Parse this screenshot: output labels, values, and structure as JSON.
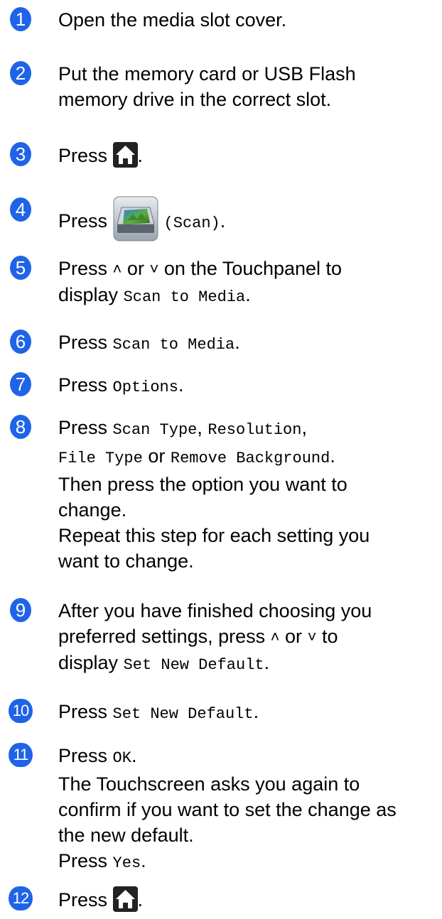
{
  "steps": [
    {
      "num": "1",
      "text": "Open the media slot cover."
    },
    {
      "num": "2",
      "line1": "Put the memory card or USB Flash",
      "line2": "memory drive in the correct slot."
    },
    {
      "num": "3",
      "pre": "Press",
      "post": "."
    },
    {
      "num": "4",
      "pre": "Press",
      "mono": "(Scan)",
      "post": "."
    },
    {
      "num": "5",
      "pre": "Press",
      "or": "or",
      "rest": "on the Touchpanel to",
      "l2pre": "display",
      "mono": "Scan to Media",
      "post": "."
    },
    {
      "num": "6",
      "pre": "Press",
      "mono": "Scan to Media",
      "post": "."
    },
    {
      "num": "7",
      "pre": "Press",
      "mono": "Options",
      "post": "."
    },
    {
      "num": "8",
      "pre": "Press",
      "mono1": "Scan Type",
      "sep": ",",
      "mono2": "Resolution",
      "sep2": ",",
      "mono3": "File Type",
      "or": "or",
      "mono4": "Remove Background",
      "post": ".",
      "line3": "Then press the option you want to",
      "line4": "change.",
      "line5": "Repeat this step for each setting you",
      "line6": "want to change."
    },
    {
      "num": "9",
      "line1": "After you have finished choosing you",
      "l2pre": "preferred settings, press",
      "or": "or",
      "l2post": "to",
      "l3pre": "display",
      "mono": "Set New Default",
      "post": "."
    },
    {
      "num": "10",
      "pre": "Press",
      "mono": "Set New Default",
      "post": "."
    },
    {
      "num": "11",
      "pre": "Press",
      "mono": "OK",
      "post": ".",
      "line2": "The Touchscreen asks you again to",
      "line3": "confirm if you want to set the change as",
      "line4": "the new default.",
      "l5pre": "Press",
      "mono2": "Yes",
      "post2": "."
    },
    {
      "num": "12",
      "pre": "Press",
      "post": "."
    }
  ],
  "icons": {
    "home": "home-icon",
    "scan": "scan-icon",
    "up": "chevron-up-icon",
    "down": "chevron-down-icon",
    "badge_color": "#1f63e8"
  }
}
